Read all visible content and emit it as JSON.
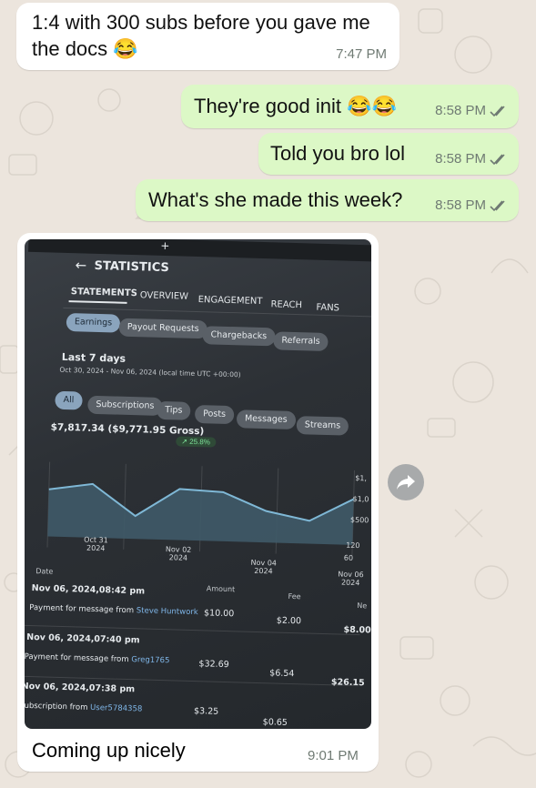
{
  "messages": [
    {
      "direction": "incoming",
      "text_line1": "1:4 with 300 subs before you gave me",
      "text_line2": "the docs 😂",
      "time": "7:47 PM"
    },
    {
      "direction": "outgoing",
      "text": "They're good init 😂😂",
      "time": "8:58 PM",
      "status": "read"
    },
    {
      "direction": "outgoing",
      "text": "Told you bro lol",
      "time": "8:58 PM",
      "status": "read"
    },
    {
      "direction": "outgoing",
      "text": "What's she made this week?",
      "time": "8:58 PM",
      "status": "read"
    },
    {
      "direction": "incoming",
      "caption": "Coming up nicely",
      "time": "9:01 PM"
    }
  ],
  "photo": {
    "plus": "+",
    "title": "STATISTICS",
    "tabs": [
      "STATEMENTS",
      "OVERVIEW",
      "ENGAGEMENT",
      "REACH",
      "FANS"
    ],
    "subtabs": [
      "Earnings",
      "Payout Requests",
      "Chargebacks",
      "Referrals"
    ],
    "period_title": "Last 7 days",
    "period_range": "Oct 30, 2024 - Nov 06, 2024 (local time UTC +00:00)",
    "filters": [
      "All",
      "Subscriptions",
      "Tips",
      "Posts",
      "Messages",
      "Streams"
    ],
    "total": "$7,817.34 ($9,771.95 Gross)",
    "growth": "↗ 25.8%",
    "y_labels": [
      "$1,",
      "$1,0",
      "$500",
      "120",
      "60"
    ],
    "chart_data": {
      "type": "area",
      "x_ticks": [
        {
          "line1": "Oct 31",
          "line2": "2024"
        },
        {
          "line1": "Nov 02",
          "line2": "2024"
        },
        {
          "line1": "Nov 04",
          "line2": "2024"
        },
        {
          "line1": "Nov 06",
          "line2": "2024"
        }
      ],
      "series": [
        {
          "values": [
            0.72,
            0.82,
            0.35,
            0.78,
            0.75,
            0.48,
            0.35,
            0.7
          ]
        },
        {
          "values": [
            0.6,
            0.45,
            0.4,
            0.4,
            0.35,
            0.2,
            0.15,
            0.1
          ]
        }
      ],
      "colors": {
        "earnings": "#7fb8d6",
        "count": "#c9cdd0"
      }
    },
    "table_headers": {
      "date": "Date",
      "amount": "Amount",
      "fee": "Fee",
      "net": "Ne"
    },
    "rows": [
      {
        "date": "Nov 06, 2024,08:42 pm",
        "desc": "Payment for message from ",
        "user": "Steve Huntwork",
        "amount": "$10.00",
        "fee": "$2.00",
        "net": "$8.00"
      },
      {
        "date": "Nov 06, 2024,07:40 pm",
        "desc": "Payment for message from ",
        "user": "Greg1765",
        "amount": "$32.69",
        "fee": "$6.54",
        "net": "$26.15"
      },
      {
        "date": "Nov 06, 2024,07:38 pm",
        "desc": "Subscription from ",
        "user": "User5784358",
        "amount": "$3.25",
        "fee": "$0.65",
        "net": ""
      }
    ]
  },
  "colors": {
    "incoming": "#ffffff",
    "outgoing": "#dcf8c6",
    "read_ticks": "#6f7a73",
    "wallpaper": "#ece5dd"
  }
}
